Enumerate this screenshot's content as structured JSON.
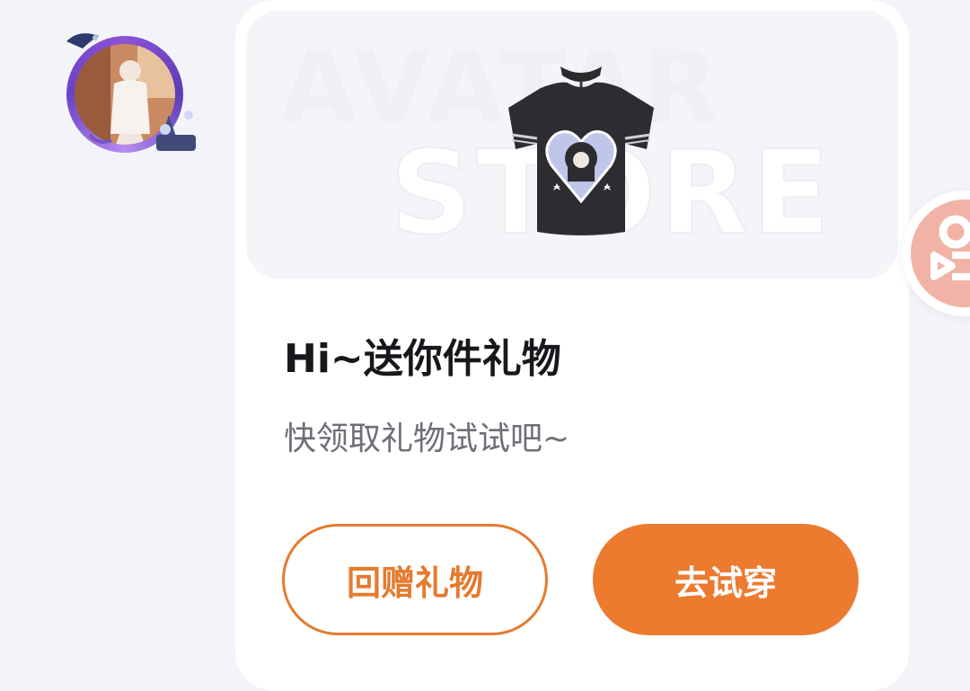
{
  "card": {
    "banner": {
      "watermark_line1": "AVATAR",
      "watermark_line2": "STORE"
    },
    "title": "Hi~送你件礼物",
    "subtitle": "快领取礼物试试吧~",
    "buttons": {
      "return_gift": "回赠礼物",
      "try_on": "去试穿"
    }
  },
  "colors": {
    "accent": "#ec7a2f",
    "page_background": "#f3f4f9",
    "card_background": "#ffffff",
    "title": "#17181c",
    "subtitle": "#6d6f78"
  },
  "icons": {
    "avatar": "user-avatar",
    "product": "t-shirt-icon",
    "floating": "video-camera-icon"
  }
}
